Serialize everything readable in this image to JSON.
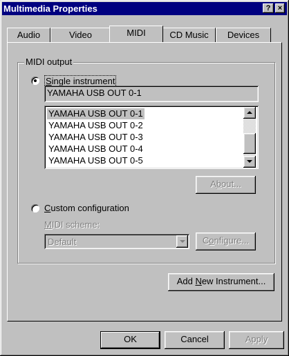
{
  "window": {
    "title": "Multimedia Properties",
    "help_label": "?",
    "close_label": "×"
  },
  "tabs": [
    {
      "label": "Audio"
    },
    {
      "label": "Video"
    },
    {
      "label": "MIDI"
    },
    {
      "label": "CD Music"
    },
    {
      "label": "Devices"
    }
  ],
  "midi_output": {
    "group_label": "MIDI output",
    "single_instrument": {
      "pre": "",
      "mnemonic": "S",
      "post": "ingle instrument",
      "selected": true
    },
    "current_instrument": "YAMAHA USB OUT 0-1",
    "instruments": [
      "YAMAHA USB OUT 0-1",
      "YAMAHA USB OUT 0-2",
      "YAMAHA USB OUT 0-3",
      "YAMAHA USB OUT 0-4",
      "YAMAHA USB OUT 0-5"
    ],
    "about_button": {
      "pre": "A",
      "mnemonic": "b",
      "post": "out..."
    },
    "custom_configuration": {
      "pre": "",
      "mnemonic": "C",
      "post": "ustom configuration",
      "selected": false
    },
    "midi_scheme_label": {
      "pre": "",
      "mnemonic": "M",
      "post": "IDI scheme:"
    },
    "midi_scheme_value": "Default",
    "configure_button": {
      "pre": "C",
      "mnemonic": "o",
      "post": "nfigure..."
    }
  },
  "add_instrument_button": {
    "pre": "Add ",
    "mnemonic": "N",
    "post": "ew Instrument..."
  },
  "footer": {
    "ok_label": "OK",
    "cancel_label": "Cancel",
    "apply_label": "Apply"
  },
  "icons": {
    "scroll_up": "arrow-up-icon",
    "scroll_down": "arrow-down-icon",
    "dropdown": "chevron-down-icon"
  }
}
